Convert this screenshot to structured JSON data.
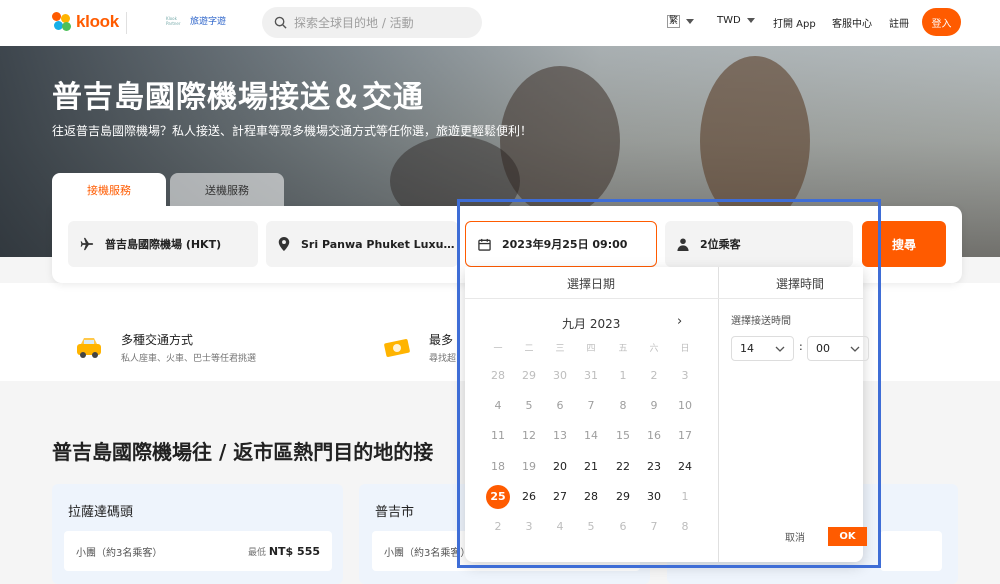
{
  "header": {
    "logo_text": "klook",
    "partner_text": "旅遊字遊",
    "partner_tiny": "Klook Partner",
    "search_placeholder": "探索全球目的地 / 活動",
    "lang": "繁",
    "currency": "TWD",
    "open_app": "打開 App",
    "help": "客服中心",
    "signup": "註冊",
    "login": "登入"
  },
  "hero": {
    "title": "普吉島國際機場接送＆交通",
    "subtitle": "往返普吉島國際機場？私人接送、計程車等眾多機場交通方式等任你選，旅遊更輕鬆便利！"
  },
  "tabs": [
    "接機服務",
    "送機服務"
  ],
  "search_form": {
    "from": "普吉島國際機場 (HKT)",
    "to": "Sri Panwa Phuket Luxury Pool Villa Hotel",
    "datetime": "2023年9月25日 09:00",
    "passengers": "2位乘客",
    "submit": "搜尋"
  },
  "features": [
    {
      "title": "多種交通方式",
      "subtitle": "私人座車、火車、巴士等任君挑選"
    },
    {
      "title": "最多",
      "subtitle": "尋找超"
    }
  ],
  "section_title": "普吉島國際機場往 / 返市區熱門目的地的接",
  "destinations": [
    {
      "name": "拉薩達碼頭",
      "vehicle": "小團（約3名乘客）",
      "price_prefix": "最低",
      "price": "NT$ 555"
    },
    {
      "name": "普吉市",
      "vehicle": "小團（約3名乘客）"
    }
  ],
  "picker": {
    "date_header": "選擇日期",
    "time_header": "選擇時間",
    "month_label": "九月 2023",
    "next_icon": "chevron-right-icon",
    "weekdays": [
      "一",
      "二",
      "三",
      "四",
      "五",
      "六",
      "日"
    ],
    "weeks": [
      [
        "28",
        "29",
        "30",
        "31",
        "1",
        "2",
        "3"
      ],
      [
        "4",
        "5",
        "6",
        "7",
        "8",
        "9",
        "10"
      ],
      [
        "11",
        "12",
        "13",
        "14",
        "15",
        "16",
        "17"
      ],
      [
        "18",
        "19",
        "20",
        "21",
        "22",
        "23",
        "24"
      ],
      [
        "25",
        "26",
        "27",
        "28",
        "29",
        "30",
        "1"
      ],
      [
        "2",
        "3",
        "4",
        "5",
        "6",
        "7",
        "8"
      ]
    ],
    "selected_day": "25",
    "time_label": "選擇接送時間",
    "hour": "14",
    "minute": "00",
    "colon": ":",
    "cancel": "取消",
    "ok": "OK"
  },
  "colors": {
    "accent": "#ff5b00",
    "highlight": "#3e6dd6"
  }
}
